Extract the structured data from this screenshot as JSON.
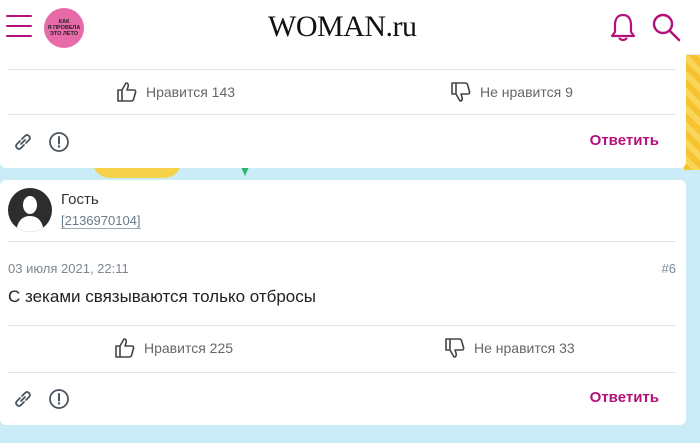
{
  "header": {
    "logo": "WOMAN.ru",
    "promo_text": "КАК\nЯ ПРОВЕЛА\nЭТО ЛЕТО"
  },
  "comments": [
    {
      "likes_label": "Нравится 143",
      "dislikes_label": "Не нравится 9",
      "reply_label": "Ответить"
    },
    {
      "author": "Гость",
      "author_id": "[2136970104]",
      "date": "03 июля 2021, 22:11",
      "number": "#6",
      "text": "С зеками связываются только отбросы",
      "likes_label": "Нравится 225",
      "dislikes_label": "Не нравится 33",
      "reply_label": "Ответить"
    }
  ],
  "colors": {
    "accent": "#b3127a",
    "background": "#c9ecf6"
  },
  "icons": [
    "menu-icon",
    "bell-icon",
    "search-icon",
    "thumbs-up-icon",
    "thumbs-down-icon",
    "link-icon",
    "report-icon",
    "avatar-icon"
  ]
}
